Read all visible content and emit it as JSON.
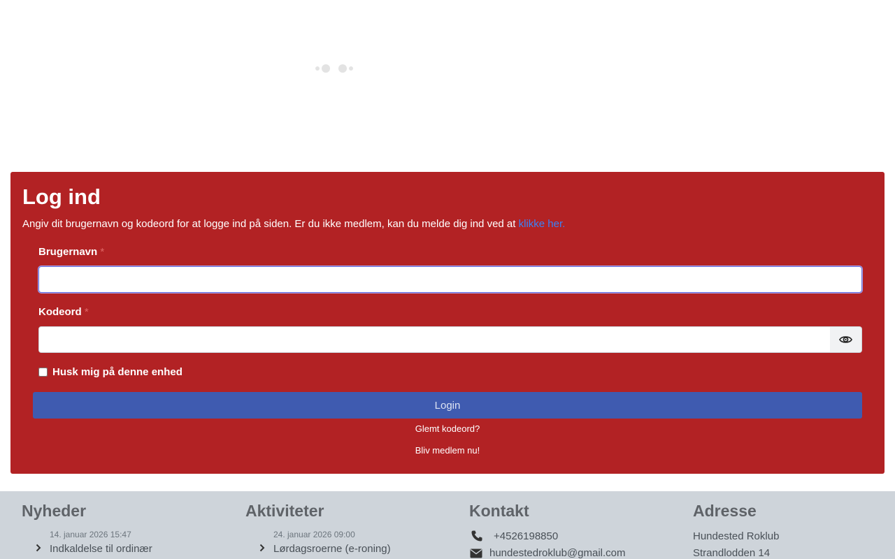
{
  "login": {
    "title": "Log ind",
    "intro": "Angiv dit brugernavn og kodeord for at logge ind på siden. Er du ikke medlem, kan du melde dig ind ved at",
    "intro_link": "klikke her.",
    "username_label": "Brugernavn",
    "password_label": "Kodeord",
    "required_mark": "*",
    "username_value": "",
    "password_value": "",
    "remember_label": "Husk mig på denne enhed",
    "remember_checked": false,
    "submit_label": "Login",
    "forgot_label": "Glemt kodeord?",
    "join_label": "Bliv medlem nu!"
  },
  "footer": {
    "news": {
      "heading": "Nyheder",
      "date": "14. januar 2026 15:47",
      "item": "Indkaldelse til ordinær"
    },
    "activities": {
      "heading": "Aktiviteter",
      "date": "24. januar 2026 09:00",
      "item": "Lørdagsroerne (e-roning)"
    },
    "contact": {
      "heading": "Kontakt",
      "phone": "+4526198850",
      "email": "hundestedroklub@gmail.com"
    },
    "address": {
      "heading": "Adresse",
      "line1": "Hundested Roklub",
      "line2": "Strandlodden 14"
    }
  },
  "icons": {
    "loader": "loading-dots-icon",
    "eye": "eye-icon",
    "chevron": "chevron-right-icon",
    "phone": "phone-icon",
    "email": "envelope-icon"
  },
  "colors": {
    "panel": "#b22224",
    "button": "#3f5bb0",
    "link": "#3b82f6",
    "footer": "#ced4da"
  }
}
